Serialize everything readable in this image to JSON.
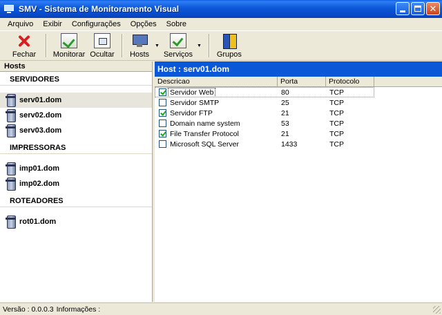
{
  "window": {
    "title": "SMV - Sistema de Monitoramento Visual",
    "min_label": "_",
    "close_label": "✕"
  },
  "menu": [
    "Arquivo",
    "Exibir",
    "Configurações",
    "Opções",
    "Sobre"
  ],
  "toolbar": {
    "fechar": "Fechar",
    "monitorar": "Monitorar",
    "ocultar": "Ocultar",
    "hosts": "Hosts",
    "servicos": "Serviços",
    "grupos": "Grupos",
    "dropdown_glyph": "▼"
  },
  "left": {
    "header": "Hosts",
    "groups": [
      {
        "title": "SERVIDORES",
        "hosts": [
          "serv01.dom",
          "serv02.dom",
          "serv03.dom"
        ]
      },
      {
        "title": "IMPRESSORAS",
        "hosts": [
          "imp01.dom",
          "imp02.dom"
        ]
      },
      {
        "title": "ROTEADORES",
        "hosts": [
          "rot01.dom"
        ]
      }
    ],
    "selected_host": "serv01.dom"
  },
  "right": {
    "header": "Host : serv01.dom",
    "columns": [
      "Descricao",
      "Porta",
      "Protocolo"
    ],
    "rows": [
      {
        "checked": true,
        "descricao": "Servidor Web",
        "porta": "80",
        "protocolo": "TCP"
      },
      {
        "checked": false,
        "descricao": "Servidor SMTP",
        "porta": "25",
        "protocolo": "TCP"
      },
      {
        "checked": true,
        "descricao": "Servidor FTP",
        "porta": "21",
        "protocolo": "TCP"
      },
      {
        "checked": false,
        "descricao": "Domain name system",
        "porta": "53",
        "protocolo": "TCP"
      },
      {
        "checked": true,
        "descricao": "File Transfer Protocol",
        "porta": "21",
        "protocolo": "TCP"
      },
      {
        "checked": false,
        "descricao": "Microsoft SQL Server",
        "porta": "1433",
        "protocolo": "TCP"
      }
    ]
  },
  "status": {
    "version": "Versão : 0.0.0.3",
    "info": "Informações :"
  }
}
